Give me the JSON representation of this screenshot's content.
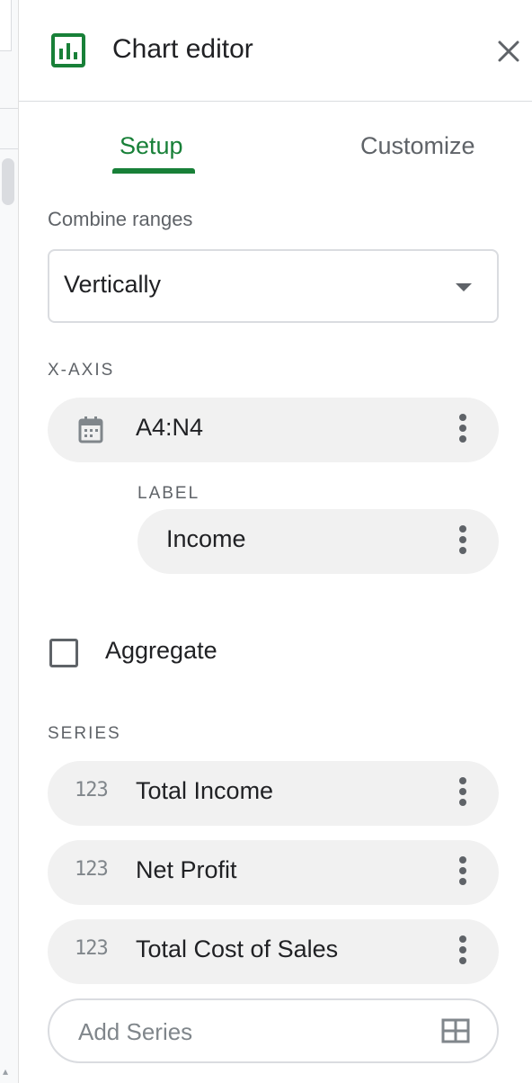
{
  "header": {
    "title": "Chart editor"
  },
  "tabs": [
    {
      "label": "Setup"
    },
    {
      "label": "Customize"
    }
  ],
  "combine_ranges": {
    "label": "Combine ranges",
    "value": "Vertically"
  },
  "x_axis": {
    "section_label": "X-AXIS",
    "range": "A4:N4",
    "label_heading": "LABEL",
    "label_value": "Income"
  },
  "aggregate": {
    "label": "Aggregate",
    "checked": false
  },
  "series": {
    "section_label": "SERIES",
    "items": [
      {
        "name": "Total Income"
      },
      {
        "name": "Net Profit"
      },
      {
        "name": "Total Cost of Sales"
      }
    ],
    "add_label": "Add Series"
  },
  "icons": {
    "type_icon_text": "123"
  },
  "colors": {
    "accent": "#188038",
    "chip_bg": "#f1f1f1",
    "muted_text": "#5f6368"
  }
}
